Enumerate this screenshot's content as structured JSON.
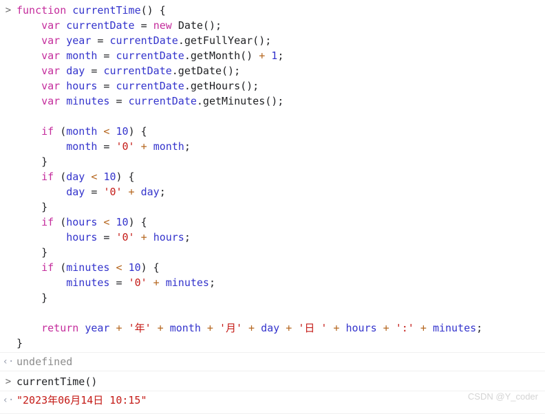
{
  "console": {
    "prompt_marker": ">",
    "result_marker": "‹·",
    "entries": [
      {
        "type": "input",
        "lines": [
          [
            {
              "t": "kw",
              "v": "function "
            },
            {
              "t": "fname",
              "v": "currentTime"
            },
            {
              "t": "punc",
              "v": "() {"
            }
          ],
          [
            {
              "t": "punc",
              "v": "    "
            },
            {
              "t": "kw",
              "v": "var "
            },
            {
              "t": "ident",
              "v": "currentDate"
            },
            {
              "t": "punc",
              "v": " = "
            },
            {
              "t": "kw",
              "v": "new "
            },
            {
              "t": "plain",
              "v": "Date();"
            }
          ],
          [
            {
              "t": "punc",
              "v": "    "
            },
            {
              "t": "kw",
              "v": "var "
            },
            {
              "t": "ident",
              "v": "year"
            },
            {
              "t": "punc",
              "v": " = "
            },
            {
              "t": "ident",
              "v": "currentDate"
            },
            {
              "t": "plain",
              "v": ".getFullYear();"
            }
          ],
          [
            {
              "t": "punc",
              "v": "    "
            },
            {
              "t": "kw",
              "v": "var "
            },
            {
              "t": "ident",
              "v": "month"
            },
            {
              "t": "punc",
              "v": " = "
            },
            {
              "t": "ident",
              "v": "currentDate"
            },
            {
              "t": "plain",
              "v": ".getMonth() "
            },
            {
              "t": "op",
              "v": "+ "
            },
            {
              "t": "num",
              "v": "1"
            },
            {
              "t": "punc",
              "v": ";"
            }
          ],
          [
            {
              "t": "punc",
              "v": "    "
            },
            {
              "t": "kw",
              "v": "var "
            },
            {
              "t": "ident",
              "v": "day"
            },
            {
              "t": "punc",
              "v": " = "
            },
            {
              "t": "ident",
              "v": "currentDate"
            },
            {
              "t": "plain",
              "v": ".getDate();"
            }
          ],
          [
            {
              "t": "punc",
              "v": "    "
            },
            {
              "t": "kw",
              "v": "var "
            },
            {
              "t": "ident",
              "v": "hours"
            },
            {
              "t": "punc",
              "v": " = "
            },
            {
              "t": "ident",
              "v": "currentDate"
            },
            {
              "t": "plain",
              "v": ".getHours();"
            }
          ],
          [
            {
              "t": "punc",
              "v": "    "
            },
            {
              "t": "kw",
              "v": "var "
            },
            {
              "t": "ident",
              "v": "minutes"
            },
            {
              "t": "punc",
              "v": " = "
            },
            {
              "t": "ident",
              "v": "currentDate"
            },
            {
              "t": "plain",
              "v": ".getMinutes();"
            }
          ],
          [],
          [
            {
              "t": "punc",
              "v": "    "
            },
            {
              "t": "kw",
              "v": "if"
            },
            {
              "t": "punc",
              "v": " ("
            },
            {
              "t": "ident",
              "v": "month"
            },
            {
              "t": "op",
              "v": " < "
            },
            {
              "t": "num",
              "v": "10"
            },
            {
              "t": "punc",
              "v": ") {"
            }
          ],
          [
            {
              "t": "punc",
              "v": "        "
            },
            {
              "t": "ident",
              "v": "month"
            },
            {
              "t": "punc",
              "v": " = "
            },
            {
              "t": "str",
              "v": "'0'"
            },
            {
              "t": "op",
              "v": " + "
            },
            {
              "t": "ident",
              "v": "month"
            },
            {
              "t": "punc",
              "v": ";"
            }
          ],
          [
            {
              "t": "punc",
              "v": "    }"
            }
          ],
          [
            {
              "t": "punc",
              "v": "    "
            },
            {
              "t": "kw",
              "v": "if"
            },
            {
              "t": "punc",
              "v": " ("
            },
            {
              "t": "ident",
              "v": "day"
            },
            {
              "t": "op",
              "v": " < "
            },
            {
              "t": "num",
              "v": "10"
            },
            {
              "t": "punc",
              "v": ") {"
            }
          ],
          [
            {
              "t": "punc",
              "v": "        "
            },
            {
              "t": "ident",
              "v": "day"
            },
            {
              "t": "punc",
              "v": " = "
            },
            {
              "t": "str",
              "v": "'0'"
            },
            {
              "t": "op",
              "v": " + "
            },
            {
              "t": "ident",
              "v": "day"
            },
            {
              "t": "punc",
              "v": ";"
            }
          ],
          [
            {
              "t": "punc",
              "v": "    }"
            }
          ],
          [
            {
              "t": "punc",
              "v": "    "
            },
            {
              "t": "kw",
              "v": "if"
            },
            {
              "t": "punc",
              "v": " ("
            },
            {
              "t": "ident",
              "v": "hours"
            },
            {
              "t": "op",
              "v": " < "
            },
            {
              "t": "num",
              "v": "10"
            },
            {
              "t": "punc",
              "v": ") {"
            }
          ],
          [
            {
              "t": "punc",
              "v": "        "
            },
            {
              "t": "ident",
              "v": "hours"
            },
            {
              "t": "punc",
              "v": " = "
            },
            {
              "t": "str",
              "v": "'0'"
            },
            {
              "t": "op",
              "v": " + "
            },
            {
              "t": "ident",
              "v": "hours"
            },
            {
              "t": "punc",
              "v": ";"
            }
          ],
          [
            {
              "t": "punc",
              "v": "    }"
            }
          ],
          [
            {
              "t": "punc",
              "v": "    "
            },
            {
              "t": "kw",
              "v": "if"
            },
            {
              "t": "punc",
              "v": " ("
            },
            {
              "t": "ident",
              "v": "minutes"
            },
            {
              "t": "op",
              "v": " < "
            },
            {
              "t": "num",
              "v": "10"
            },
            {
              "t": "punc",
              "v": ") {"
            }
          ],
          [
            {
              "t": "punc",
              "v": "        "
            },
            {
              "t": "ident",
              "v": "minutes"
            },
            {
              "t": "punc",
              "v": " = "
            },
            {
              "t": "str",
              "v": "'0'"
            },
            {
              "t": "op",
              "v": " + "
            },
            {
              "t": "ident",
              "v": "minutes"
            },
            {
              "t": "punc",
              "v": ";"
            }
          ],
          [
            {
              "t": "punc",
              "v": "    }"
            }
          ],
          [],
          [
            {
              "t": "punc",
              "v": "    "
            },
            {
              "t": "kw",
              "v": "return "
            },
            {
              "t": "ident",
              "v": "year"
            },
            {
              "t": "op",
              "v": " + "
            },
            {
              "t": "str",
              "v": "'年'"
            },
            {
              "t": "op",
              "v": " + "
            },
            {
              "t": "ident",
              "v": "month"
            },
            {
              "t": "op",
              "v": " + "
            },
            {
              "t": "str",
              "v": "'月'"
            },
            {
              "t": "op",
              "v": " + "
            },
            {
              "t": "ident",
              "v": "day"
            },
            {
              "t": "op",
              "v": " + "
            },
            {
              "t": "str",
              "v": "'日 '"
            },
            {
              "t": "op",
              "v": " + "
            },
            {
              "t": "ident",
              "v": "hours"
            },
            {
              "t": "op",
              "v": " + "
            },
            {
              "t": "str",
              "v": "':'"
            },
            {
              "t": "op",
              "v": " + "
            },
            {
              "t": "ident",
              "v": "minutes"
            },
            {
              "t": "punc",
              "v": ";"
            }
          ],
          [
            {
              "t": "punc",
              "v": "}"
            }
          ]
        ]
      },
      {
        "type": "output",
        "lines": [
          [
            {
              "t": "gray",
              "v": "undefined"
            }
          ]
        ]
      },
      {
        "type": "input",
        "lines": [
          [
            {
              "t": "dark",
              "v": "currentTime()"
            }
          ]
        ]
      },
      {
        "type": "output",
        "lines": [
          [
            {
              "t": "str",
              "v": "\"2023年06月14日 10:15\""
            }
          ]
        ]
      }
    ]
  },
  "watermark": {
    "text": "CSDN @Y_coder"
  }
}
